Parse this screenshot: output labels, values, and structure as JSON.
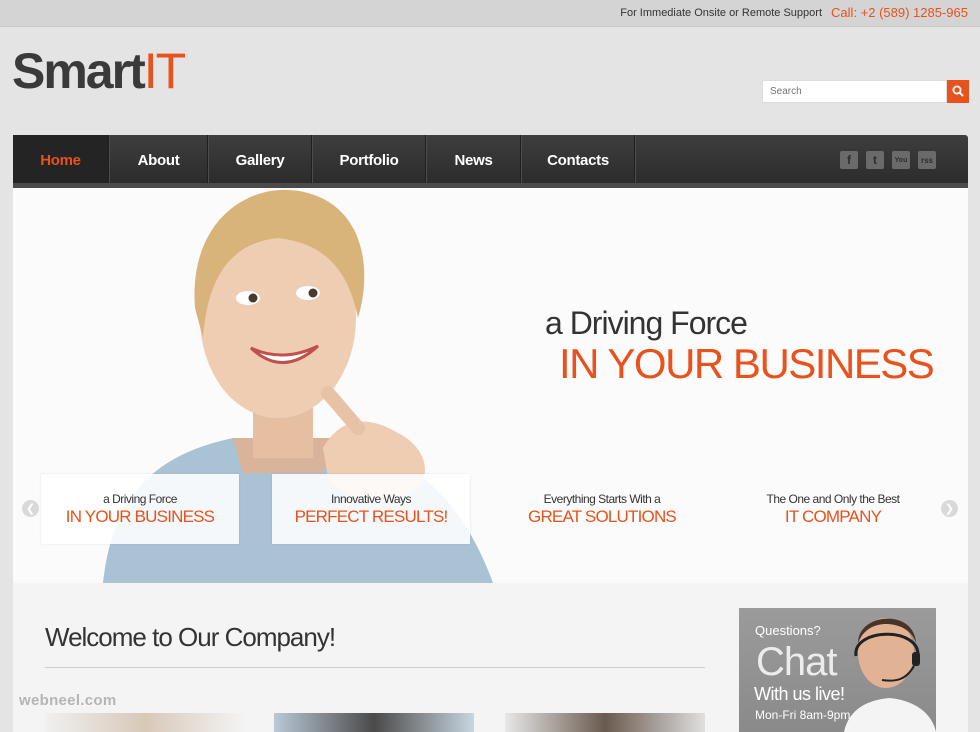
{
  "topbar": {
    "support_text": "For Immediate Onsite or Remote Support",
    "phone": "Call: +2 (589) 1285-965"
  },
  "logo": {
    "part1": "Smart",
    "part2": "IT"
  },
  "search": {
    "placeholder": "Search"
  },
  "nav": {
    "items": [
      {
        "label": "Home",
        "active": true
      },
      {
        "label": "About"
      },
      {
        "label": "Gallery"
      },
      {
        "label": "Portfolio"
      },
      {
        "label": "News"
      },
      {
        "label": "Contacts"
      }
    ],
    "social_icons": [
      "facebook-icon",
      "twitter-icon",
      "youtube-icon",
      "rss-icon"
    ],
    "social_glyphs": [
      "f",
      "t",
      "You",
      "rss"
    ]
  },
  "hero": {
    "line1": "a Driving Force",
    "line2": "IN YOUR BUSINESS",
    "slides": [
      {
        "small": "a Driving Force",
        "big": "IN YOUR BUSINESS"
      },
      {
        "small": "Innovative Ways",
        "big": "PERFECT RESULTS!"
      },
      {
        "small": "Everything Starts With a",
        "big": "GREAT SOLUTIONS"
      },
      {
        "small": "The One and Only the Best",
        "big": "IT COMPANY"
      }
    ]
  },
  "content": {
    "welcome_title": "Welcome to Our Company!"
  },
  "watermark": "webneel.com",
  "chat": {
    "question": "Questions?",
    "big": "Chat",
    "live": "With us live!",
    "hours": "Mon-Fri 8am-9pm"
  },
  "colors": {
    "accent": "#e8521c",
    "nav_bg": "#333333",
    "page_bg": "#e4e4e4"
  }
}
